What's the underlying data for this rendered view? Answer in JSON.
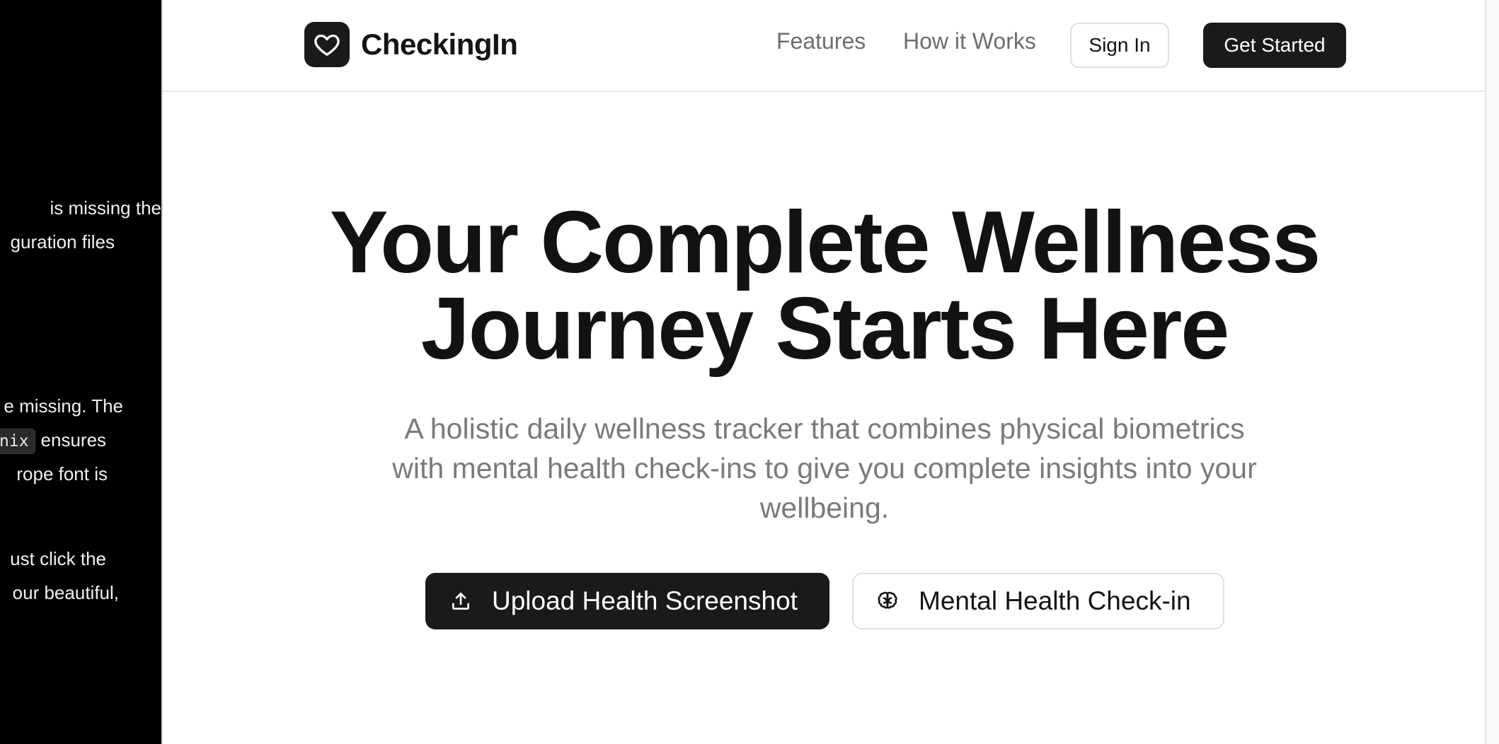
{
  "left_panel": {
    "lines": [
      "is missing the",
      "guration files",
      "e missing. The",
      "ensures",
      "rope font is",
      "ust click the",
      "our beautiful,"
    ],
    "code_chip": "nix"
  },
  "nav": {
    "brand": "CheckingIn",
    "links": [
      "Features",
      "How it Works"
    ],
    "sign_in": "Sign In",
    "get_started": "Get Started"
  },
  "hero": {
    "title_line1": "Your Complete Wellness",
    "title_line2": "Journey Starts Here",
    "subtitle": "A holistic daily wellness tracker that combines physical biometrics with mental health check-ins to give you complete insights into your wellbeing.",
    "cta_primary": "Upload Health Screenshot",
    "cta_secondary": "Mental Health Check-in"
  },
  "icons": {
    "brand": "heart-icon",
    "cta_primary": "upload-icon",
    "cta_secondary": "brain-icon"
  },
  "colors": {
    "primary": "#1a1a1a",
    "muted_text": "#7a7a7a",
    "background": "#ffffff"
  }
}
